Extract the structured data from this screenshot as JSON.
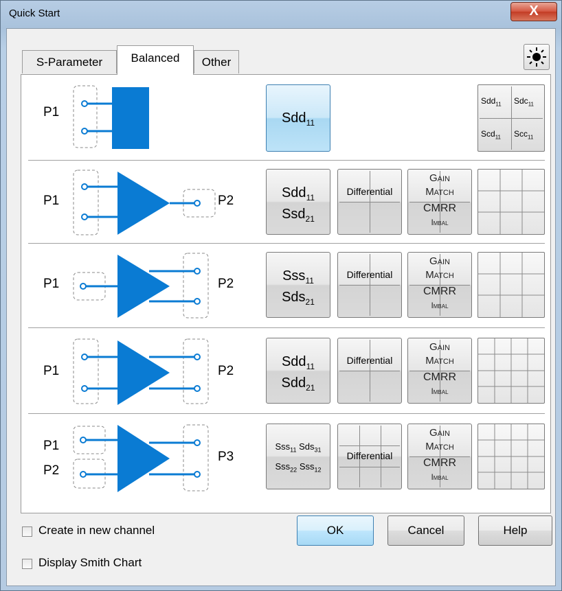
{
  "window": {
    "title": "Quick Start",
    "close_glyph": "X"
  },
  "tabs": [
    {
      "label": "S-Parameter",
      "active": false
    },
    {
      "label": "Balanced",
      "active": true
    },
    {
      "label": "Other",
      "active": false
    }
  ],
  "toolbar": {
    "sun_icon": "sun-icon"
  },
  "rows": [
    {
      "ports_left": [
        "P1"
      ],
      "port_right": "",
      "param_lines": [
        "Sdd",
        "11"
      ],
      "matrix": {
        "a": [
          "Sdd",
          "11"
        ],
        "b": [
          "Sdc",
          "11"
        ],
        "c": [
          "Scd",
          "11"
        ],
        "d": [
          "Scc",
          "11"
        ]
      }
    },
    {
      "ports_left": [
        "P1"
      ],
      "port_right": "P2",
      "param_lines": [
        [
          "Sdd",
          "11"
        ],
        [
          "Ssd",
          "21"
        ]
      ],
      "diff_label": "Differential",
      "gm": [
        "Gain",
        "Match",
        "CMRR",
        "Imbal"
      ]
    },
    {
      "ports_left": [
        "P1"
      ],
      "port_right": "P2",
      "param_lines": [
        [
          "Sss",
          "11"
        ],
        [
          "Sds",
          "21"
        ]
      ],
      "diff_label": "Differential",
      "gm": [
        "Gain",
        "Match",
        "CMRR",
        "Imbal"
      ]
    },
    {
      "ports_left": [
        "P1"
      ],
      "port_right": "P2",
      "param_lines": [
        [
          "Sdd",
          "11"
        ],
        [
          "Sdd",
          "21"
        ]
      ],
      "diff_label": "Differential",
      "gm": [
        "Gain",
        "Match",
        "CMRR",
        "Imbal"
      ]
    },
    {
      "ports_left": [
        "P1",
        "P2"
      ],
      "port_right": "P3",
      "param_lines": [
        [
          "Sss",
          "11",
          "Sds",
          "31"
        ],
        [
          "Sss",
          "22",
          "Sss",
          "12"
        ]
      ],
      "diff_label": "Differential",
      "gm": [
        "Gain",
        "Match",
        "CMRR",
        "Imbal"
      ]
    }
  ],
  "checkboxes": [
    {
      "label": "Create in new channel",
      "checked": false
    },
    {
      "label": "Display Smith Chart",
      "checked": false
    }
  ],
  "buttons": {
    "ok": "OK",
    "cancel": "Cancel",
    "help": "Help"
  },
  "colors": {
    "accent": "#0a7bd3",
    "button_blue": "#a9d8f2"
  }
}
